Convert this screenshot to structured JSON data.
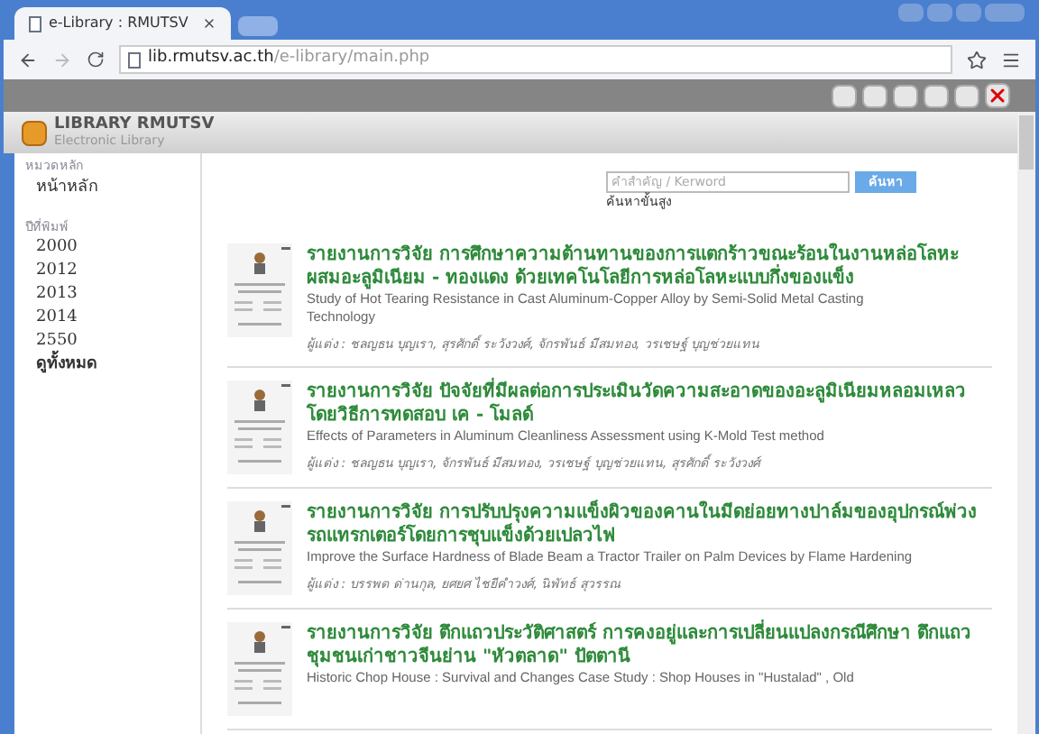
{
  "browser": {
    "tab_title": "e-Library : RMUTSV",
    "url_host": "lib.rmutsv.ac.th",
    "url_path": "/e-library/main.php"
  },
  "header": {
    "logo_title": "LIBRARY RMUTSV",
    "logo_subtitle": "Electronic Library"
  },
  "sidebar": {
    "sections": [
      {
        "heading": "หมวดหลัก",
        "items": [
          {
            "label": "หน้าหลัก",
            "bold": false
          }
        ]
      },
      {
        "heading": "ปีที่พิมพ์",
        "items": [
          {
            "label": "2000",
            "bold": false
          },
          {
            "label": "2012",
            "bold": false
          },
          {
            "label": "2013",
            "bold": false
          },
          {
            "label": "2014",
            "bold": false
          },
          {
            "label": "2550",
            "bold": false
          },
          {
            "label": "ดูทั้งหมด",
            "bold": true
          }
        ]
      }
    ]
  },
  "search": {
    "placeholder": "คำสำคัญ / Kerword",
    "button": "ค้นหา",
    "advanced_link": "ค้นหาขั้นสูง"
  },
  "results": [
    {
      "title": "รายงานการวิจัย การศึกษาความต้านทานของการแตกร้าวขณะร้อนในงานหล่อโลหะผสมอะลูมิเนียม - ทองแดง ด้วยเทคโนโลยีการหล่อโลหะแบบกึ่งของแข็ง",
      "english": "Study of Hot Tearing Resistance in Cast Aluminum-Copper Alloy by Semi-Solid Metal Casting Technology",
      "authors": "ผู้แต่ง : ชลญธน บุญเรา, สุรศักดิ์ ระวังวงศ์, จักรพันธ์ มีสมทอง, วรเชษฐ์ บุญช่วยแทน"
    },
    {
      "title": "รายงานการวิจัย ปัจจัยที่มีผลต่อการประเมินวัดความสะอาดของอะลูมิเนียมหลอมเหลวโดยวิธีการทดสอบ เค - โมลด์",
      "english": "Effects of Parameters in Aluminum Cleanliness Assessment using K-Mold Test method",
      "authors": "ผู้แต่ง : ชลญธน บุญเรา, จักรพันธ์ มีสมทอง, วรเชษฐ์ บุญช่วยแทน, สุรศักดิ์ ระวังวงศ์"
    },
    {
      "title": "รายงานการวิจัย การปรับปรุงความแข็งผิวของคานในมีดย่อยทางปาล์มของอุปกรณ์พ่วงรถแทรกเตอร์โดยการชุบแข็งด้วยเปลวไฟ",
      "english": "Improve the Surface Hardness of Blade Beam a Tractor Trailer on Palm Devices by Flame Hardening",
      "authors": "ผู้แต่ง : บรรพต ด่านกุล, ยศยศ ไชยีคำวงศ์, นิพัทธ์ สุวรรณ"
    },
    {
      "title": "รายงานการวิจัย ตึกแถวประวัติศาสตร์ การคงอยู่และการเปลี่ยนแปลงกรณีศึกษา ตึกแถว ชุมชนเก่าชาวจีนย่าน \"หัวตลาด\" ปัตตานี",
      "english": "Historic Chop House : Survival and Changes Case Study : Shop Houses in \"Hustalad\" , Old"
    }
  ]
}
